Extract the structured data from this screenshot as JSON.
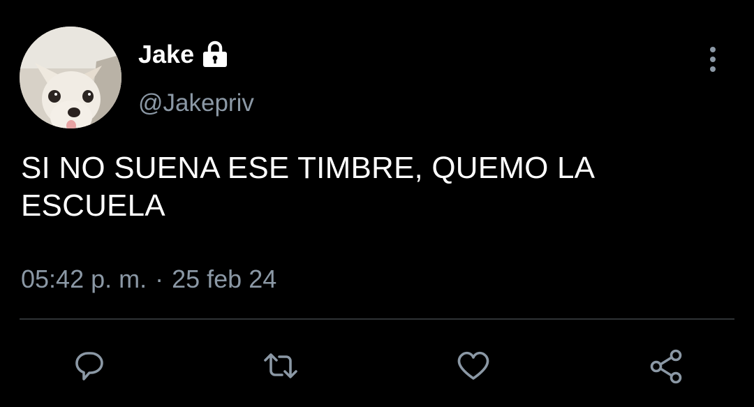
{
  "author": {
    "display_name": "Jake",
    "handle": "@Jakepriv",
    "avatar_icon": "chihuahua-avatar",
    "protected_icon": "lock-icon"
  },
  "tweet": {
    "text": "SI NO SUENA ESE TIMBRE, QUEMO LA ESCUELA",
    "time": "05:42 p. m.",
    "separator": "·",
    "date": "25 feb 24"
  },
  "actions": [
    {
      "name": "reply",
      "icon": "reply-icon"
    },
    {
      "name": "retweet",
      "icon": "retweet-icon"
    },
    {
      "name": "like",
      "icon": "heart-icon"
    },
    {
      "name": "share",
      "icon": "share-icon"
    }
  ],
  "colors": {
    "background": "#000000",
    "primary_text": "#ffffff",
    "secondary_text": "#8b98a5",
    "divider": "#2f3336"
  }
}
